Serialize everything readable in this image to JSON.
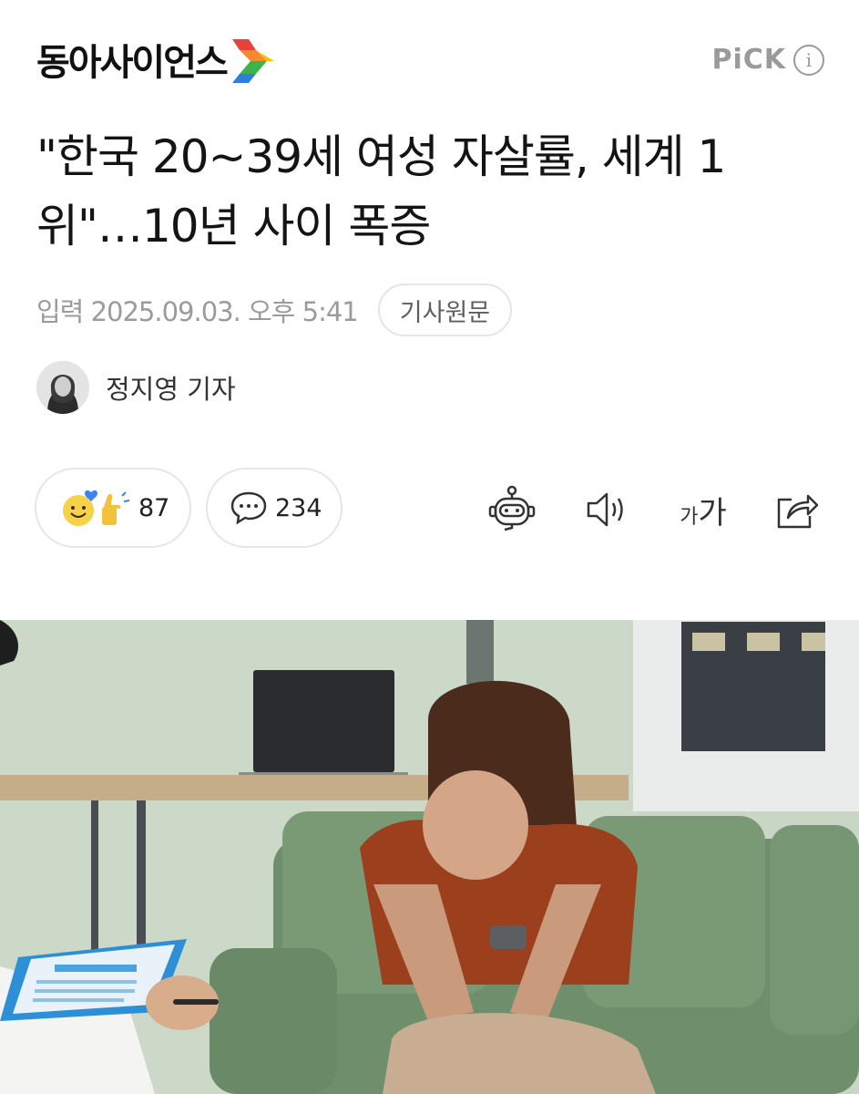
{
  "header": {
    "logo_text": "동아사이언스",
    "pick_label": "PiCK",
    "info_icon_text": "i"
  },
  "article": {
    "title": "\"한국 20~39세 여성 자살률, 세계 1위\"…10년 사이 폭증",
    "published": "입력 2025.09.03. 오후 5:41",
    "source_button": "기사원문",
    "reporter": "정지영 기자"
  },
  "actions": {
    "reaction_count": "87",
    "comment_count": "234",
    "fontsize_small": "가",
    "fontsize_large": "가"
  },
  "colors": {
    "logo_accent_red": "#e8433a",
    "logo_accent_green": "#3bb54a",
    "logo_accent_blue": "#2f7fd8",
    "muted_text": "#9b9b9b",
    "pill_border": "#e6e6e6"
  },
  "icons": [
    "logo-mark-icon",
    "info-icon",
    "reaction-emoji-icon",
    "speech-bubble-icon",
    "ai-robot-icon",
    "speaker-icon",
    "font-size-icon",
    "share-icon"
  ]
}
